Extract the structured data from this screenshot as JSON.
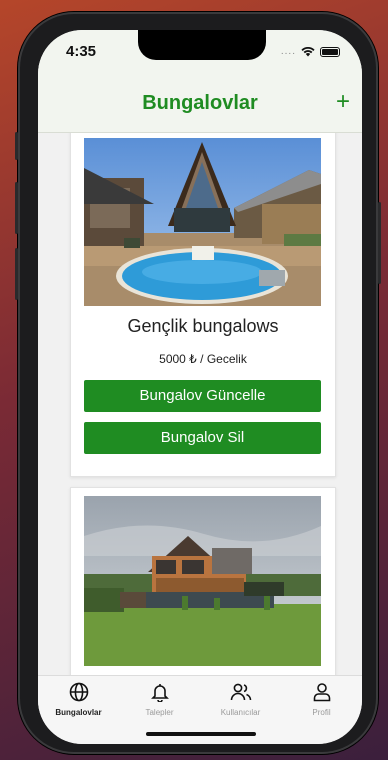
{
  "status_bar": {
    "time": "4:35",
    "dots": "....",
    "icons": [
      "wifi-icon",
      "battery-icon"
    ]
  },
  "header": {
    "title": "Bungalovlar",
    "add_label": "+"
  },
  "listings": [
    {
      "name": "Gençlik bungalows",
      "price": "5000 ₺ / Gecelik",
      "update_label": "Bungalov Güncelle",
      "delete_label": "Bungalov Sil"
    }
  ],
  "tabs": [
    {
      "label": "Bungalovlar",
      "icon": "globe-icon",
      "active": true
    },
    {
      "label": "Talepler",
      "icon": "bell-icon",
      "active": false
    },
    {
      "label": "Kullanıcılar",
      "icon": "users-icon",
      "active": false
    },
    {
      "label": "Profil",
      "icon": "person-icon",
      "active": false
    }
  ],
  "colors": {
    "accent": "#1f8c22",
    "background": "#f1f1f1"
  }
}
